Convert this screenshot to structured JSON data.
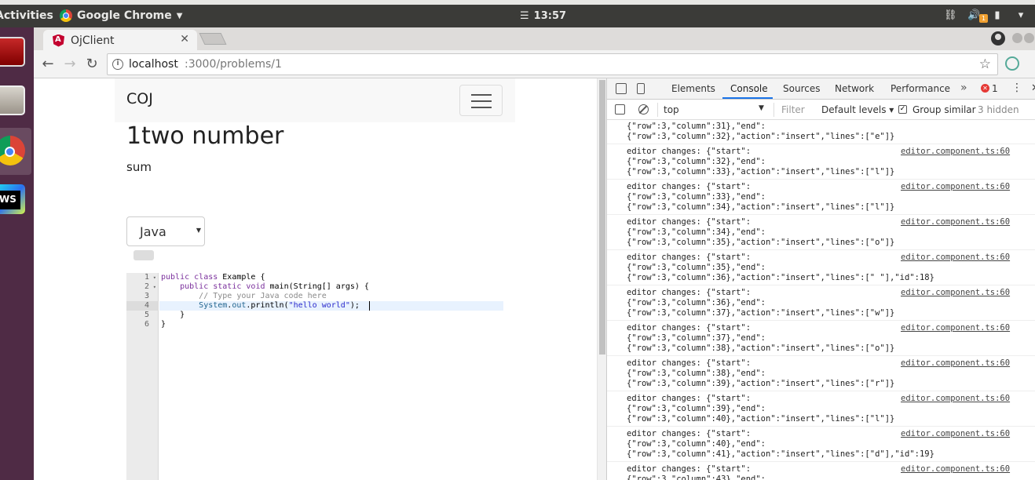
{
  "system": {
    "activities": "Activities",
    "app_menu": "Google Chrome",
    "clock": "13:57"
  },
  "browser": {
    "tab_title": "OjClient",
    "tab_close": "✕",
    "url_host": "localhost",
    "url_path": ":3000/problems/1"
  },
  "page": {
    "brand": "COJ",
    "problem_title": "1two number",
    "problem_desc": "sum",
    "language": "Java"
  },
  "editor": {
    "line_numbers": [
      "1",
      "2",
      "3",
      "4",
      "5",
      "6"
    ],
    "fold_markers": [
      "▾",
      "▾",
      "",
      "",
      "",
      ""
    ],
    "lines": [
      "public class Example {",
      "    public static void main(String[] args) {",
      "        // Type your Java code here",
      "        System.out.println(\"hello world\");",
      "    }",
      "}"
    ]
  },
  "devtools": {
    "tabs": [
      "Elements",
      "Console",
      "Sources",
      "Network",
      "Performance"
    ],
    "active_tab": "Console",
    "more_tabs": "»",
    "error_count": "1",
    "context": "top",
    "filter_placeholder": "Filter",
    "levels": "Default levels ▾",
    "group_similar": "Group similar",
    "hidden": "3 hidden",
    "messages": [
      {
        "lines": [
          "{\"row\":3,\"column\":31},\"end\":",
          "{\"row\":3,\"column\":32},\"action\":\"insert\",\"lines\":[\"e\"]}"
        ],
        "source": ""
      },
      {
        "lines": [
          "editor changes: {\"start\":",
          "{\"row\":3,\"column\":32},\"end\":",
          "{\"row\":3,\"column\":33},\"action\":\"insert\",\"lines\":[\"l\"]}"
        ],
        "source": "editor.component.ts:60"
      },
      {
        "lines": [
          "editor changes: {\"start\":",
          "{\"row\":3,\"column\":33},\"end\":",
          "{\"row\":3,\"column\":34},\"action\":\"insert\",\"lines\":[\"l\"]}"
        ],
        "source": "editor.component.ts:60"
      },
      {
        "lines": [
          "editor changes: {\"start\":",
          "{\"row\":3,\"column\":34},\"end\":",
          "{\"row\":3,\"column\":35},\"action\":\"insert\",\"lines\":[\"o\"]}"
        ],
        "source": "editor.component.ts:60"
      },
      {
        "lines": [
          "editor changes: {\"start\":",
          "{\"row\":3,\"column\":35},\"end\":",
          "{\"row\":3,\"column\":36},\"action\":\"insert\",\"lines\":[\" \"],\"id\":18}"
        ],
        "source": "editor.component.ts:60"
      },
      {
        "lines": [
          "editor changes: {\"start\":",
          "{\"row\":3,\"column\":36},\"end\":",
          "{\"row\":3,\"column\":37},\"action\":\"insert\",\"lines\":[\"w\"]}"
        ],
        "source": "editor.component.ts:60"
      },
      {
        "lines": [
          "editor changes: {\"start\":",
          "{\"row\":3,\"column\":37},\"end\":",
          "{\"row\":3,\"column\":38},\"action\":\"insert\",\"lines\":[\"o\"]}"
        ],
        "source": "editor.component.ts:60"
      },
      {
        "lines": [
          "editor changes: {\"start\":",
          "{\"row\":3,\"column\":38},\"end\":",
          "{\"row\":3,\"column\":39},\"action\":\"insert\",\"lines\":[\"r\"]}"
        ],
        "source": "editor.component.ts:60"
      },
      {
        "lines": [
          "editor changes: {\"start\":",
          "{\"row\":3,\"column\":39},\"end\":",
          "{\"row\":3,\"column\":40},\"action\":\"insert\",\"lines\":[\"l\"]}"
        ],
        "source": "editor.component.ts:60"
      },
      {
        "lines": [
          "editor changes: {\"start\":",
          "{\"row\":3,\"column\":40},\"end\":",
          "{\"row\":3,\"column\":41},\"action\":\"insert\",\"lines\":[\"d\"],\"id\":19}"
        ],
        "source": "editor.component.ts:60"
      },
      {
        "lines": [
          "editor changes: {\"start\":",
          "{\"row\":3,\"column\":43},\"end\":"
        ],
        "source": "editor.component.ts:60"
      }
    ]
  },
  "colors": {
    "ubuntu_panel": "#3b3b38",
    "launcher": "#4f2b45",
    "devtools_accent": "#1a73e8"
  }
}
